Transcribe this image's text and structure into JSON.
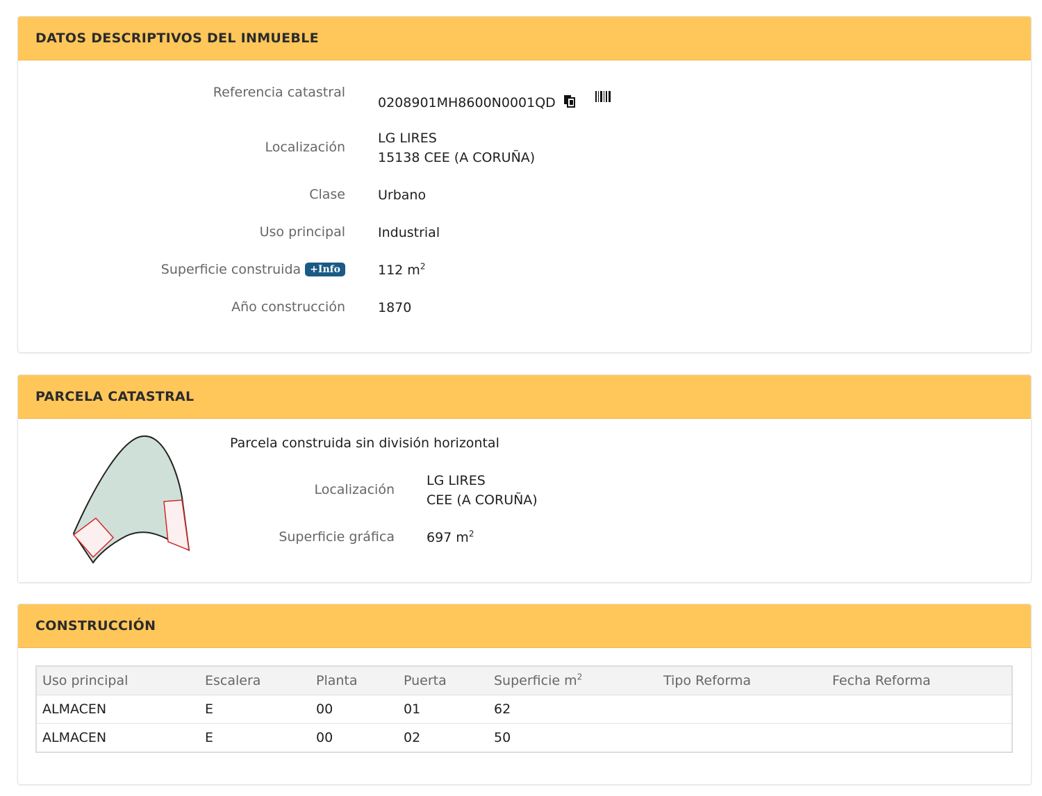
{
  "datos": {
    "title": "DATOS DESCRIPTIVOS DEL INMUEBLE",
    "referencia_label": "Referencia catastral",
    "referencia_value": "0208901MH8600N0001QD",
    "localizacion_label": "Localización",
    "localizacion_line1": "LG LIRES",
    "localizacion_line2": "15138 CEE (A CORUÑA)",
    "clase_label": "Clase",
    "clase_value": "Urbano",
    "uso_label": "Uso principal",
    "uso_value": "Industrial",
    "superficie_label": "Superficie construida",
    "info_badge": "+Info",
    "superficie_value": "112 m",
    "superficie_sup": "2",
    "anio_label": "Año construcción",
    "anio_value": "1870",
    "icons": [
      "copy-icon",
      "barcode-icon"
    ]
  },
  "parcela": {
    "title": "PARCELA CATASTRAL",
    "subtitle": "Parcela construida sin división horizontal",
    "localizacion_label": "Localización",
    "localizacion_line1": "LG LIRES",
    "localizacion_line2": "CEE (A CORUÑA)",
    "superficie_label": "Superficie gráfica",
    "superficie_value": "697 m",
    "superficie_sup": "2",
    "colors": {
      "parcel_fill": "#cfe0d8",
      "building_stroke": "#d02a2a",
      "building_fill": "#fbeff0"
    }
  },
  "construccion": {
    "title": "CONSTRUCCIÓN",
    "headers": [
      "Uso principal",
      "Escalera",
      "Planta",
      "Puerta",
      "Superficie m",
      "Tipo Reforma",
      "Fecha Reforma"
    ],
    "headers_sup": "2",
    "rows": [
      [
        "ALMACEN",
        "E",
        "00",
        "01",
        "62",
        "",
        ""
      ],
      [
        "ALMACEN",
        "E",
        "00",
        "02",
        "50",
        "",
        ""
      ]
    ]
  },
  "colors": {
    "header_bg": "#ffc75a",
    "badge_bg": "#1a5a85"
  }
}
